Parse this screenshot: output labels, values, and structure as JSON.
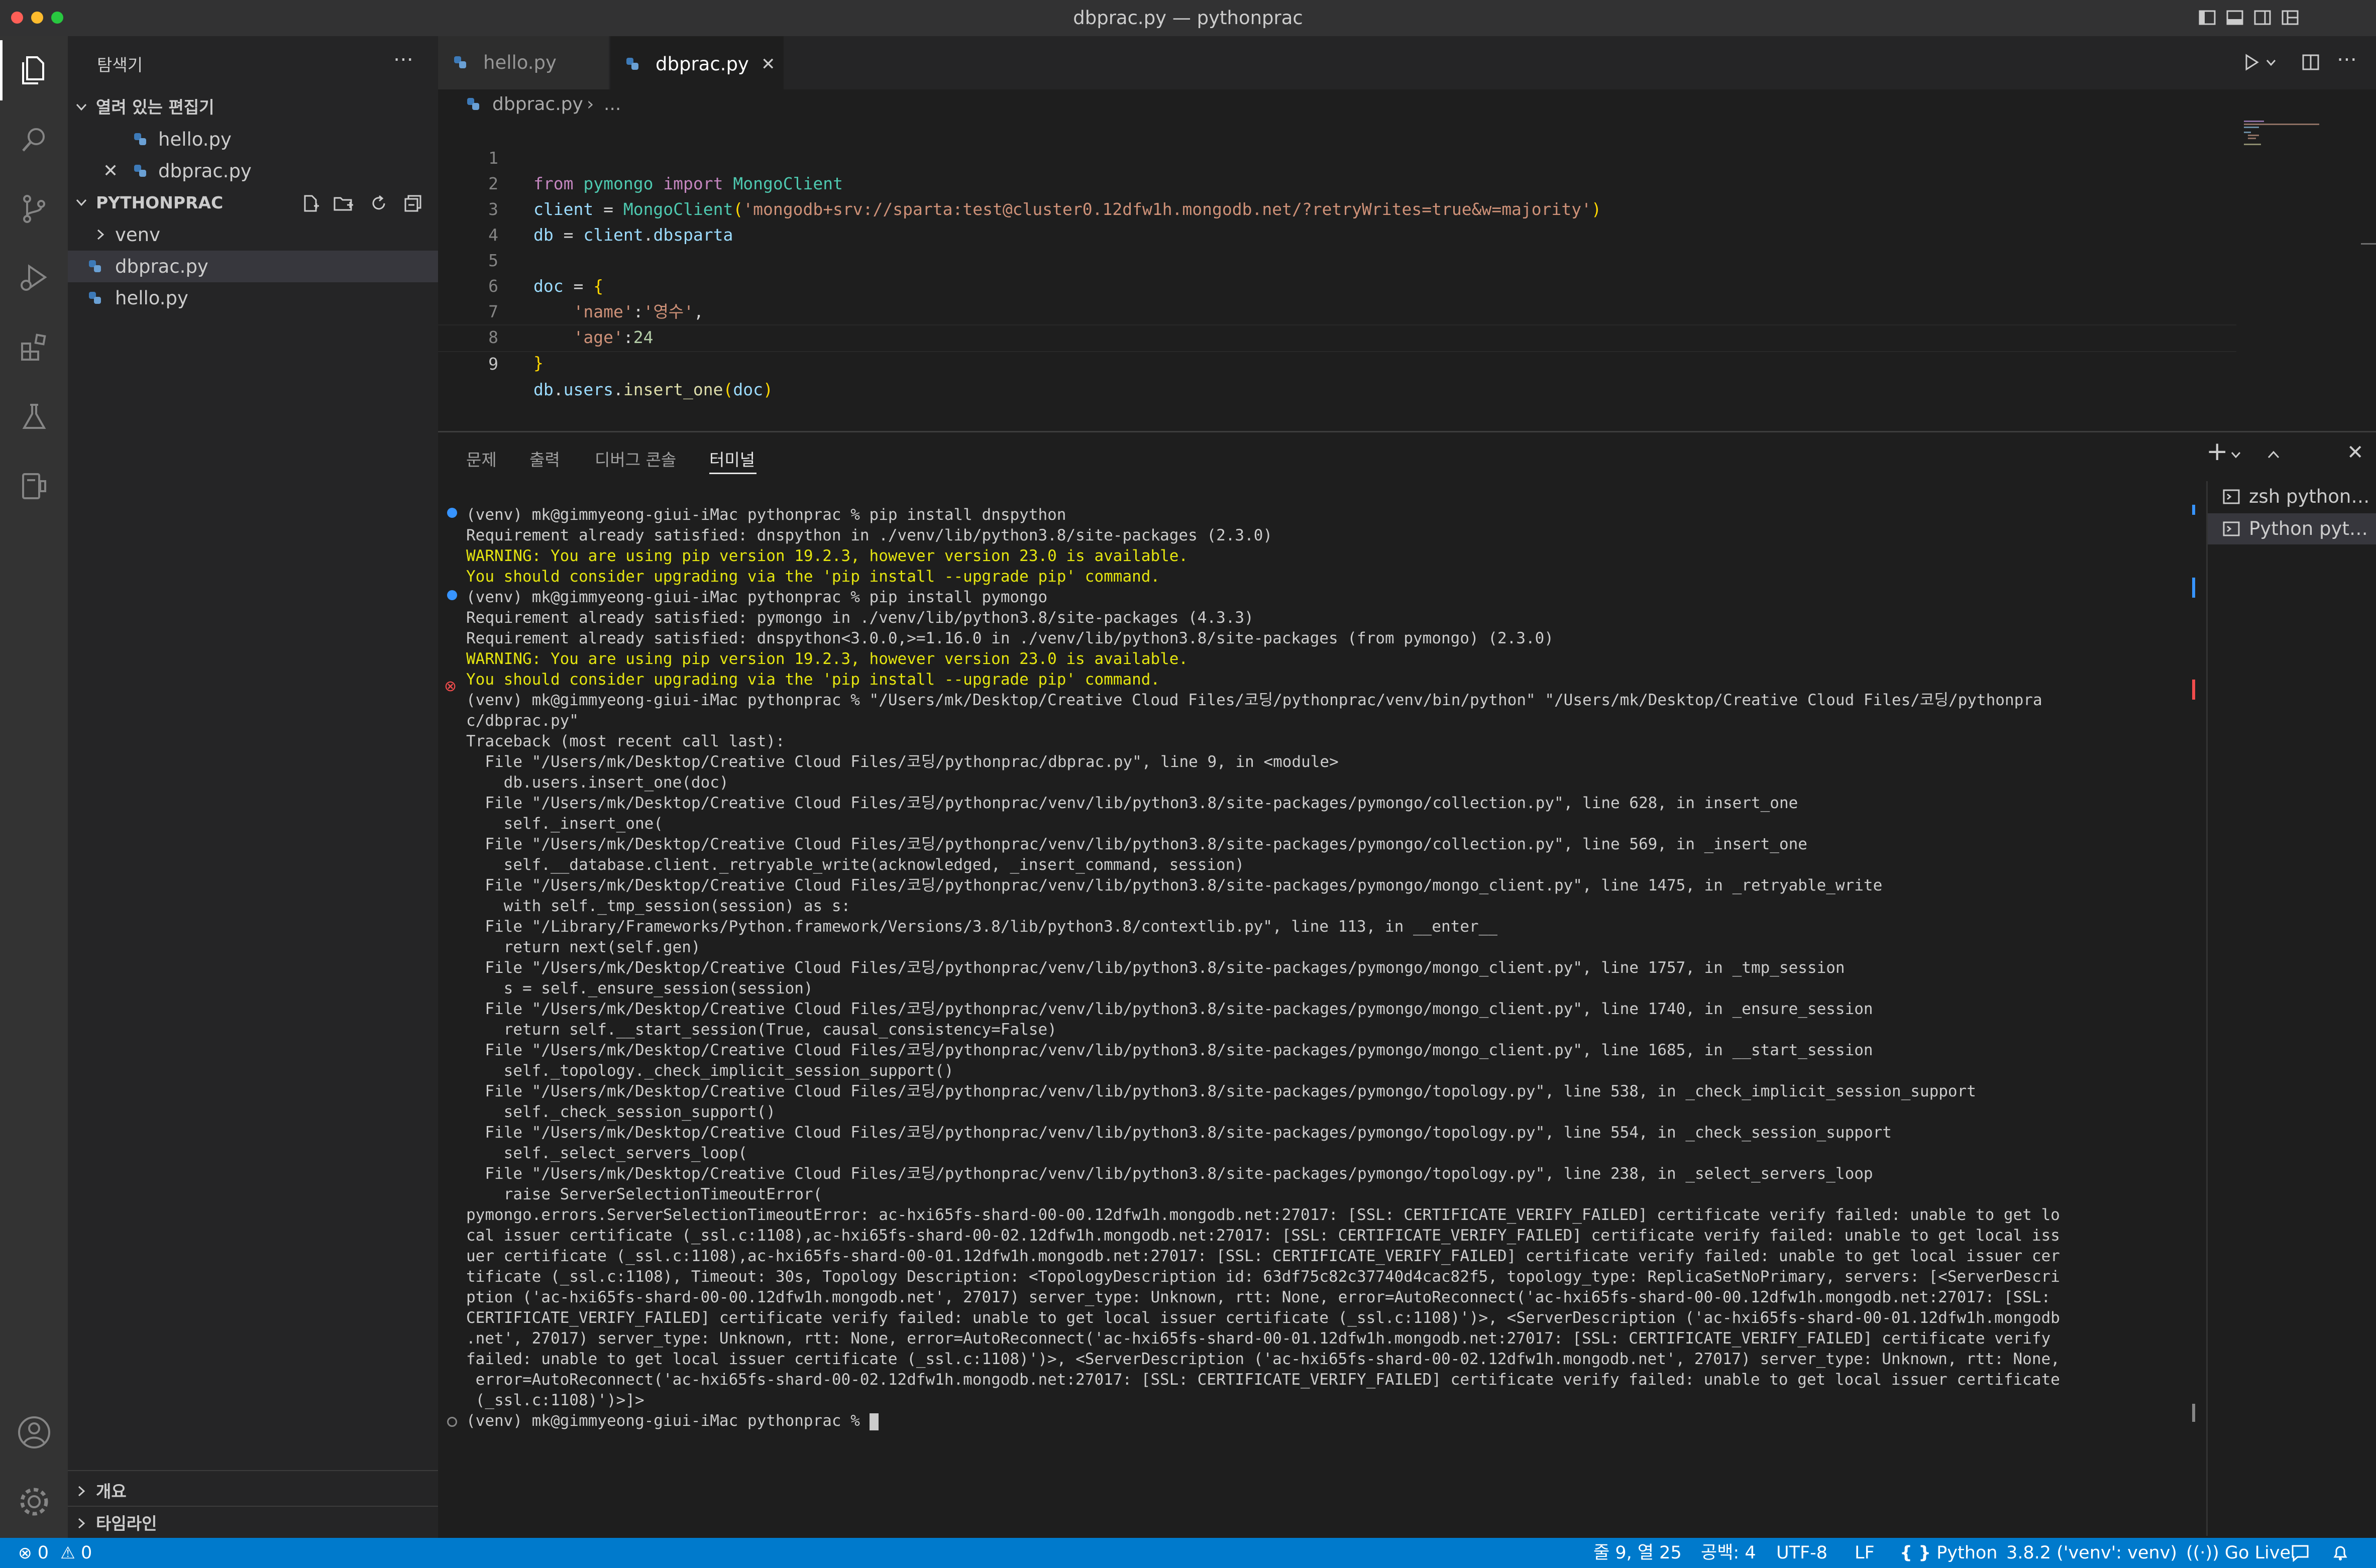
{
  "window": {
    "title": "dbprac.py — pythonprac"
  },
  "colors": {
    "accent": "#007acc",
    "warning_text": "#e5e510",
    "error_mark": "#f14c4c",
    "info_mark": "#3794ff"
  },
  "activity_bar": {
    "items": [
      "explorer-icon",
      "search-icon",
      "source-control-icon",
      "run-debug-icon",
      "extensions-icon",
      "testing-icon",
      "remote-explorer-icon"
    ],
    "bottom": [
      "account-icon",
      "settings-gear-icon"
    ]
  },
  "sidebar": {
    "title": "탐색기",
    "open_editors": {
      "label": "열려 있는 편집기",
      "items": [
        "hello.py",
        "dbprac.py"
      ]
    },
    "project": {
      "label": "PYTHONPRAC",
      "items": [
        {
          "name": "venv",
          "kind": "folder"
        },
        {
          "name": "dbprac.py",
          "kind": "file"
        },
        {
          "name": "hello.py",
          "kind": "file"
        }
      ]
    },
    "outline": "개요",
    "timeline": "타임라인"
  },
  "tabs": [
    {
      "label": "hello.py",
      "active": false
    },
    {
      "label": "dbprac.py",
      "active": true
    }
  ],
  "breadcrumb": {
    "file": "dbprac.py",
    "rest": "..."
  },
  "code": {
    "line_numbers": [
      "1",
      "2",
      "3",
      "4",
      "5",
      "6",
      "7",
      "8",
      "9"
    ],
    "l1": {
      "from": "from",
      "mod": "pymongo",
      "import": "import",
      "cls": "MongoClient"
    },
    "l2": {
      "var": "client",
      "eq": " = ",
      "cls": "MongoClient",
      "open": "(",
      "str": "'mongodb+srv://sparta:test@cluster0.12dfw1h.mongodb.net/?retryWrites=true&w=majority'",
      "close": ")"
    },
    "l3": {
      "var": "db",
      "eq": " = ",
      "obj": "client",
      "dot": ".",
      "attr": "dbsparta"
    },
    "l5": {
      "var": "doc",
      "eq": " = ",
      "brace": "{"
    },
    "l6": {
      "indent": "    ",
      "key": "'name'",
      "colon": ":",
      "val": "'영수'",
      "comma": ","
    },
    "l7": {
      "indent": "    ",
      "key": "'age'",
      "colon": ":",
      "val": "24"
    },
    "l8": {
      "brace": "}"
    },
    "l9": {
      "obj": "db",
      "dot": ".",
      "attr": "users",
      "dot2": ".",
      "fn": "insert_one",
      "open": "(",
      "arg": "doc",
      "close": ")"
    }
  },
  "panel": {
    "tabs": [
      "문제",
      "출력",
      "디버그 콘솔",
      "터미널"
    ],
    "active_tab": "터미널",
    "terminal_list": [
      "zsh  python…",
      "Python  pyt…"
    ],
    "terminal_lines": [
      "(venv) mk@gimmyeong-giui-iMac pythonprac % pip install dnspython",
      "Requirement already satisfied: dnspython in ./venv/lib/python3.8/site-packages (2.3.0)",
      "WARNING: You are using pip version 19.2.3, however version 23.0 is available.",
      "You should consider upgrading via the 'pip install --upgrade pip' command.",
      "(venv) mk@gimmyeong-giui-iMac pythonprac % pip install pymongo",
      "Requirement already satisfied: pymongo in ./venv/lib/python3.8/site-packages (4.3.3)",
      "Requirement already satisfied: dnspython<3.0.0,>=1.16.0 in ./venv/lib/python3.8/site-packages (from pymongo) (2.3.0)",
      "WARNING: You are using pip version 19.2.3, however version 23.0 is available.",
      "You should consider upgrading via the 'pip install --upgrade pip' command.",
      "(venv) mk@gimmyeong-giui-iMac pythonprac % \"/Users/mk/Desktop/Creative Cloud Files/코딩/pythonprac/venv/bin/python\" \"/Users/mk/Desktop/Creative Cloud Files/코딩/pythonpra",
      "c/dbprac.py\"",
      "Traceback (most recent call last):",
      "  File \"/Users/mk/Desktop/Creative Cloud Files/코딩/pythonprac/dbprac.py\", line 9, in <module>",
      "    db.users.insert_one(doc)",
      "  File \"/Users/mk/Desktop/Creative Cloud Files/코딩/pythonprac/venv/lib/python3.8/site-packages/pymongo/collection.py\", line 628, in insert_one",
      "    self._insert_one(",
      "  File \"/Users/mk/Desktop/Creative Cloud Files/코딩/pythonprac/venv/lib/python3.8/site-packages/pymongo/collection.py\", line 569, in _insert_one",
      "    self.__database.client._retryable_write(acknowledged, _insert_command, session)",
      "  File \"/Users/mk/Desktop/Creative Cloud Files/코딩/pythonprac/venv/lib/python3.8/site-packages/pymongo/mongo_client.py\", line 1475, in _retryable_write",
      "    with self._tmp_session(session) as s:",
      "  File \"/Library/Frameworks/Python.framework/Versions/3.8/lib/python3.8/contextlib.py\", line 113, in __enter__",
      "    return next(self.gen)",
      "  File \"/Users/mk/Desktop/Creative Cloud Files/코딩/pythonprac/venv/lib/python3.8/site-packages/pymongo/mongo_client.py\", line 1757, in _tmp_session",
      "    s = self._ensure_session(session)",
      "  File \"/Users/mk/Desktop/Creative Cloud Files/코딩/pythonprac/venv/lib/python3.8/site-packages/pymongo/mongo_client.py\", line 1740, in _ensure_session",
      "    return self.__start_session(True, causal_consistency=False)",
      "  File \"/Users/mk/Desktop/Creative Cloud Files/코딩/pythonprac/venv/lib/python3.8/site-packages/pymongo/mongo_client.py\", line 1685, in __start_session",
      "    self._topology._check_implicit_session_support()",
      "  File \"/Users/mk/Desktop/Creative Cloud Files/코딩/pythonprac/venv/lib/python3.8/site-packages/pymongo/topology.py\", line 538, in _check_implicit_session_support",
      "    self._check_session_support()",
      "  File \"/Users/mk/Desktop/Creative Cloud Files/코딩/pythonprac/venv/lib/python3.8/site-packages/pymongo/topology.py\", line 554, in _check_session_support",
      "    self._select_servers_loop(",
      "  File \"/Users/mk/Desktop/Creative Cloud Files/코딩/pythonprac/venv/lib/python3.8/site-packages/pymongo/topology.py\", line 238, in _select_servers_loop",
      "    raise ServerSelectionTimeoutError(",
      "pymongo.errors.ServerSelectionTimeoutError: ac-hxi65fs-shard-00-00.12dfw1h.mongodb.net:27017: [SSL: CERTIFICATE_VERIFY_FAILED] certificate verify failed: unable to get lo",
      "cal issuer certificate (_ssl.c:1108),ac-hxi65fs-shard-00-02.12dfw1h.mongodb.net:27017: [SSL: CERTIFICATE_VERIFY_FAILED] certificate verify failed: unable to get local iss",
      "uer certificate (_ssl.c:1108),ac-hxi65fs-shard-00-01.12dfw1h.mongodb.net:27017: [SSL: CERTIFICATE_VERIFY_FAILED] certificate verify failed: unable to get local issuer cer",
      "tificate (_ssl.c:1108), Timeout: 30s, Topology Description: <TopologyDescription id: 63df75c82c37740d4cac82f5, topology_type: ReplicaSetNoPrimary, servers: [<ServerDescri",
      "ption ('ac-hxi65fs-shard-00-00.12dfw1h.mongodb.net', 27017) server_type: Unknown, rtt: None, error=AutoReconnect('ac-hxi65fs-shard-00-00.12dfw1h.mongodb.net:27017: [SSL:",
      "CERTIFICATE_VERIFY_FAILED] certificate verify failed: unable to get local issuer certificate (_ssl.c:1108)')>, <ServerDescription ('ac-hxi65fs-shard-00-01.12dfw1h.mongodb",
      ".net', 27017) server_type: Unknown, rtt: None, error=AutoReconnect('ac-hxi65fs-shard-00-01.12dfw1h.mongodb.net:27017: [SSL: CERTIFICATE_VERIFY_FAILED] certificate verify",
      "failed: unable to get local issuer certificate (_ssl.c:1108)')>, <ServerDescription ('ac-hxi65fs-shard-00-02.12dfw1h.mongodb.net', 27017) server_type: Unknown, rtt: None,",
      " error=AutoReconnect('ac-hxi65fs-shard-00-02.12dfw1h.mongodb.net:27017: [SSL: CERTIFICATE_VERIFY_FAILED] certificate verify failed: unable to get local issuer certificate",
      " (_ssl.c:1108)')>]>",
      "(venv) mk@gimmyeong-giui-iMac pythonprac % "
    ]
  },
  "status_bar": {
    "errors": "0",
    "warnings": "0",
    "position": "줄 9, 열 25",
    "indent": "공백: 4",
    "encoding": "UTF-8",
    "eol": "LF",
    "language": "Python",
    "interpreter": "3.8.2 ('venv': venv)",
    "go_live": "Go Live"
  }
}
